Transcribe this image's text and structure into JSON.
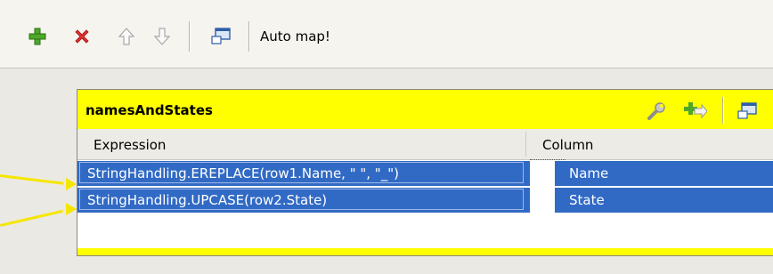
{
  "toolbar": {
    "icons": [
      "add-icon",
      "remove-icon",
      "move-up-icon",
      "move-down-icon",
      "window-icon"
    ],
    "auto_map_label": "Auto map!"
  },
  "table": {
    "title": "namesAndStates",
    "title_icons": [
      "wrench-icon",
      "add-column-icon",
      "window-icon"
    ],
    "columns": [
      "Expression",
      "Column"
    ],
    "rows": [
      {
        "expression": "StringHandling.EREPLACE(row1.Name, \" \", \"_\")",
        "column": "Name"
      },
      {
        "expression": "StringHandling.UPCASE(row2.State)",
        "column": "State"
      }
    ]
  },
  "colors": {
    "title_bar": "#ffff00",
    "selection": "#316ac5",
    "link": "#f5e600"
  }
}
